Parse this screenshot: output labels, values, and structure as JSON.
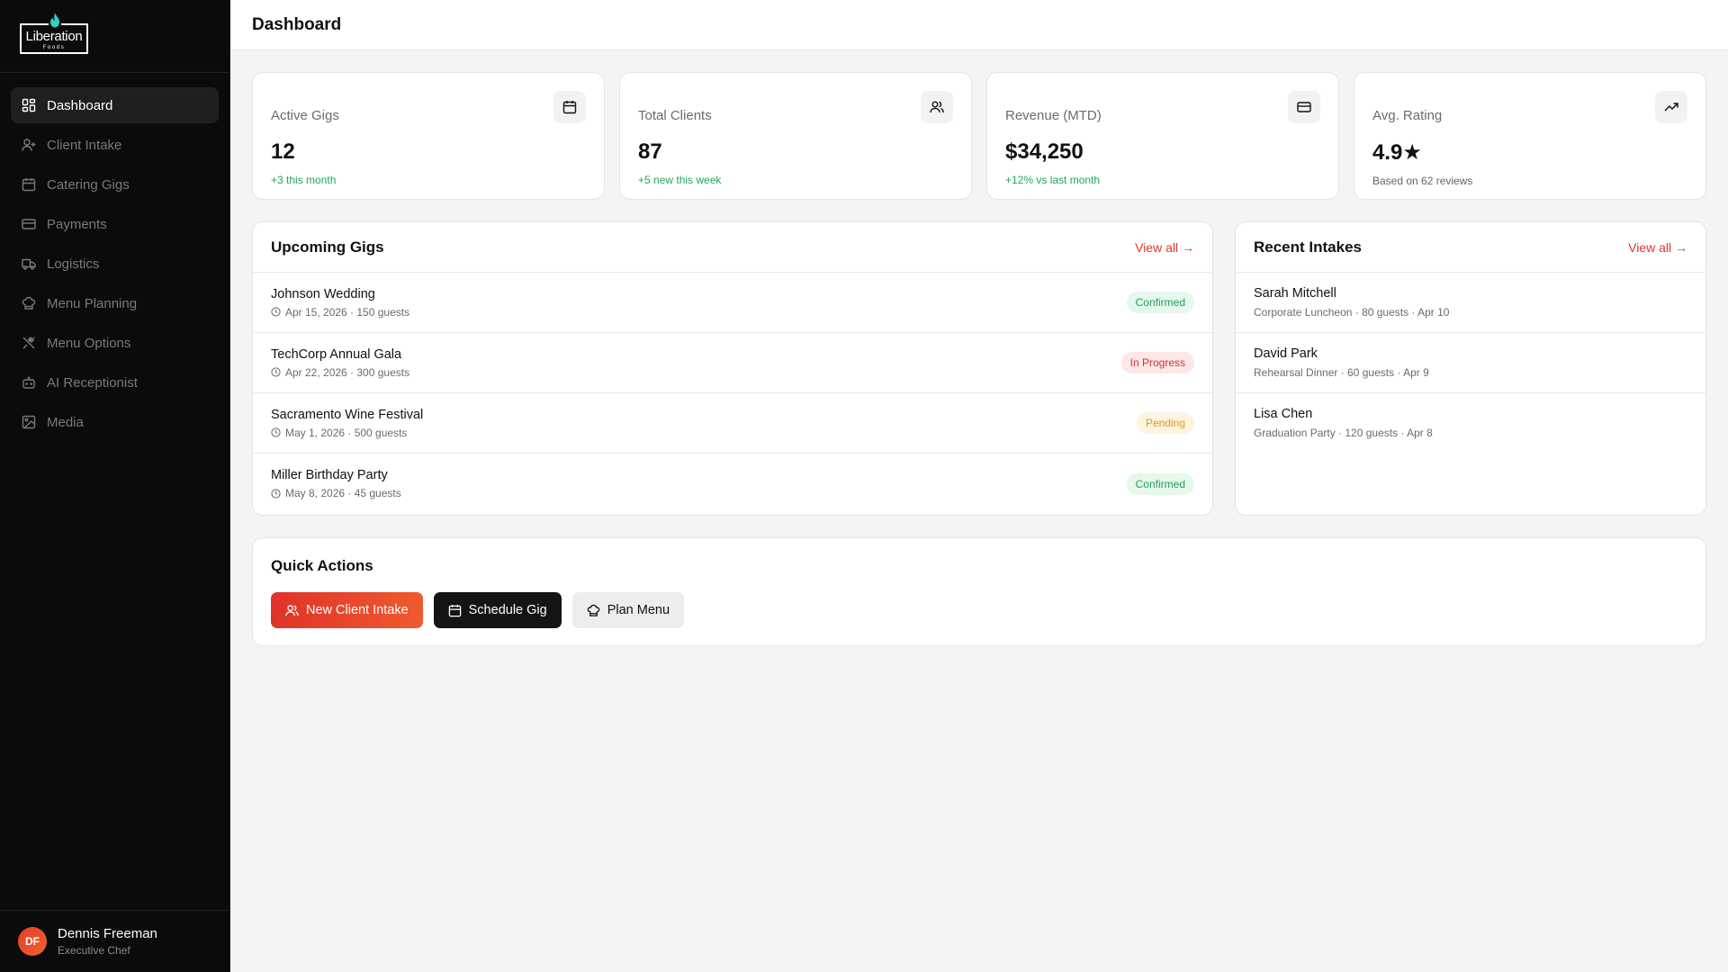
{
  "brand": {
    "name": "Liberation",
    "tagline": "Foods",
    "accent": "#e5332a",
    "flame_color": "#2fd0c8"
  },
  "sidebar": {
    "items": [
      {
        "label": "Dashboard",
        "icon": "dashboard-icon",
        "active": true
      },
      {
        "label": "Client Intake",
        "icon": "user-plus-icon"
      },
      {
        "label": "Catering Gigs",
        "icon": "calendar-icon"
      },
      {
        "label": "Payments",
        "icon": "credit-card-icon"
      },
      {
        "label": "Logistics",
        "icon": "truck-icon"
      },
      {
        "label": "Menu Planning",
        "icon": "chef-hat-icon"
      },
      {
        "label": "Menu Options",
        "icon": "utensils-icon"
      },
      {
        "label": "AI Receptionist",
        "icon": "bot-icon"
      },
      {
        "label": "Media",
        "icon": "image-icon"
      }
    ]
  },
  "user": {
    "initials": "DF",
    "name": "Dennis Freeman",
    "role": "Executive Chef"
  },
  "header": {
    "title": "Dashboard"
  },
  "stats": [
    {
      "label": "Active Gigs",
      "value": "12",
      "sub": "+3 this month",
      "icon": "calendar-icon"
    },
    {
      "label": "Total Clients",
      "value": "87",
      "sub": "+5 new this week",
      "icon": "users-icon"
    },
    {
      "label": "Revenue (MTD)",
      "value": "$34,250",
      "sub": "+12% vs last month",
      "icon": "credit-card-icon"
    },
    {
      "label": "Avg. Rating",
      "value": "4.9★",
      "sub": "Based on 62 reviews",
      "icon": "trending-up-icon"
    }
  ],
  "upcoming": {
    "title": "Upcoming Gigs",
    "view_all": "View all →",
    "rows": [
      {
        "title": "Johnson Wedding",
        "meta": "Apr 15, 2026 · 150 guests",
        "status": "Confirmed"
      },
      {
        "title": "TechCorp Annual Gala",
        "meta": "Apr 22, 2026 · 300 guests",
        "status": "In Progress"
      },
      {
        "title": "Sacramento Wine Festival",
        "meta": "May 1, 2026 · 500 guests",
        "status": "Pending"
      },
      {
        "title": "Miller Birthday Party",
        "meta": "May 8, 2026 · 45 guests",
        "status": "Confirmed"
      }
    ]
  },
  "intakes": {
    "title": "Recent Intakes",
    "view_all": "View all →",
    "rows": [
      {
        "name": "Sarah Mitchell",
        "meta": "Corporate Luncheon · 80 guests · Apr 10"
      },
      {
        "name": "David Park",
        "meta": "Rehearsal Dinner · 60 guests · Apr 9"
      },
      {
        "name": "Lisa Chen",
        "meta": "Graduation Party · 120 guests · Apr 8"
      }
    ]
  },
  "quick_actions": {
    "title": "Quick Actions",
    "buttons": [
      {
        "label": "New Client Intake",
        "icon": "users-icon"
      },
      {
        "label": "Schedule Gig",
        "icon": "calendar-icon"
      },
      {
        "label": "Plan Menu",
        "icon": "chef-hat-icon"
      }
    ]
  }
}
